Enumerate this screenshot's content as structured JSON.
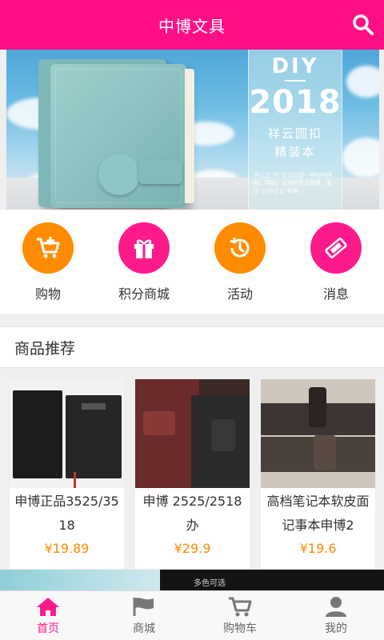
{
  "header": {
    "title": "中博文具",
    "search_icon": "search-icon"
  },
  "banner": {
    "diy": "DIY",
    "year": "2018",
    "subtitle_line1": "祥云圆扣",
    "subtitle_line2": "精装本",
    "note": "祥云之“祥”显示的是一种如何祥和、祥瑞，吉祥的生活愿景，象征“心中之云”的美"
  },
  "menu": [
    {
      "label": "购物",
      "icon": "cart-plus-icon",
      "color": "#ff8c00"
    },
    {
      "label": "积分商城",
      "icon": "gift-icon",
      "color": "#ff1a8c"
    },
    {
      "label": "活动",
      "icon": "history-icon",
      "color": "#ff8c00"
    },
    {
      "label": "消息",
      "icon": "ticket-icon",
      "color": "#ff1a8c"
    }
  ],
  "section": {
    "title": "商品推荐"
  },
  "products": [
    {
      "name": "申博正品3525/3518",
      "price": "¥19.89"
    },
    {
      "name": "申博 2525/2518办",
      "price": "¥29.9"
    },
    {
      "name": "高档笔记本软皮面记事本申博2",
      "price": "¥19.6"
    }
  ],
  "strip": {
    "text": "多色可选"
  },
  "tabbar": [
    {
      "label": "首页",
      "icon": "home-icon",
      "active": true
    },
    {
      "label": "商城",
      "icon": "flag-icon",
      "active": false
    },
    {
      "label": "购物车",
      "icon": "cart-icon",
      "active": false
    },
    {
      "label": "我的",
      "icon": "user-icon",
      "active": false
    }
  ],
  "colors": {
    "brand": "#ff0f86",
    "accent_orange": "#ff8c00",
    "price": "#ff8a00",
    "tab_active": "#ff1a8c"
  }
}
